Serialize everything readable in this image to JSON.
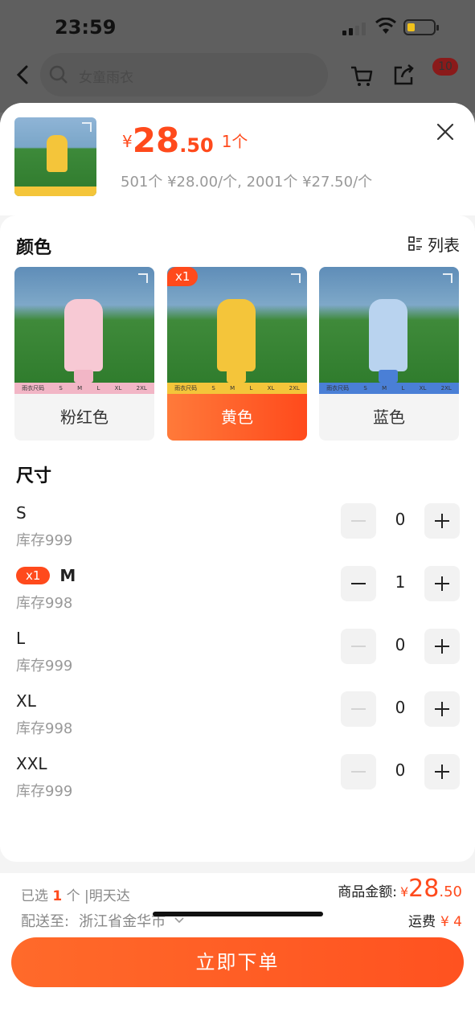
{
  "status": {
    "time": "23:59"
  },
  "nav": {
    "search_placeholder": "女童雨衣",
    "message_count": "10"
  },
  "product": {
    "price_symbol": "¥",
    "price_int": "28",
    "price_dec": ".50",
    "quantity_label": "1个",
    "tier_pricing": "501个 ¥28.00/个, 2001个 ¥27.50/个"
  },
  "colors": {
    "title": "颜色",
    "view_toggle": "列表",
    "items": [
      {
        "label": "粉红色",
        "selected": false,
        "badge": "",
        "coat": "#f7c9d4",
        "strip": "#f2b6c6"
      },
      {
        "label": "黄色",
        "selected": true,
        "badge": "x1",
        "coat": "#f4c53a",
        "strip": "#f4c53a"
      },
      {
        "label": "蓝色",
        "selected": false,
        "badge": "",
        "coat": "#b9d3ef",
        "strip": "#4a7fd6"
      }
    ],
    "strip_sizes": [
      "雨衣尺码",
      "S",
      "M",
      "L",
      "XL",
      "2XL"
    ]
  },
  "sizes": {
    "title": "尺寸",
    "items": [
      {
        "name": "S",
        "stock": "库存999",
        "qty": "0",
        "badge": ""
      },
      {
        "name": "M",
        "stock": "库存998",
        "qty": "1",
        "badge": "x1"
      },
      {
        "name": "L",
        "stock": "库存999",
        "qty": "0",
        "badge": ""
      },
      {
        "name": "XL",
        "stock": "库存998",
        "qty": "0",
        "badge": ""
      },
      {
        "name": "XXL",
        "stock": "库存999",
        "qty": "0",
        "badge": ""
      }
    ]
  },
  "footer": {
    "selected_prefix": "已选",
    "selected_count": "1",
    "selected_suffix": "个 |明天达",
    "ship_label": "配送至:",
    "ship_address": "浙江省金华市",
    "amount_label": "商品金额:",
    "amount_symbol": "¥",
    "amount_int": "28",
    "amount_dec": ".50",
    "freight_label": "运费",
    "freight_value": "¥ 4",
    "order_button": "立即下单"
  },
  "theme": {
    "accent": "#ff4a1c"
  }
}
